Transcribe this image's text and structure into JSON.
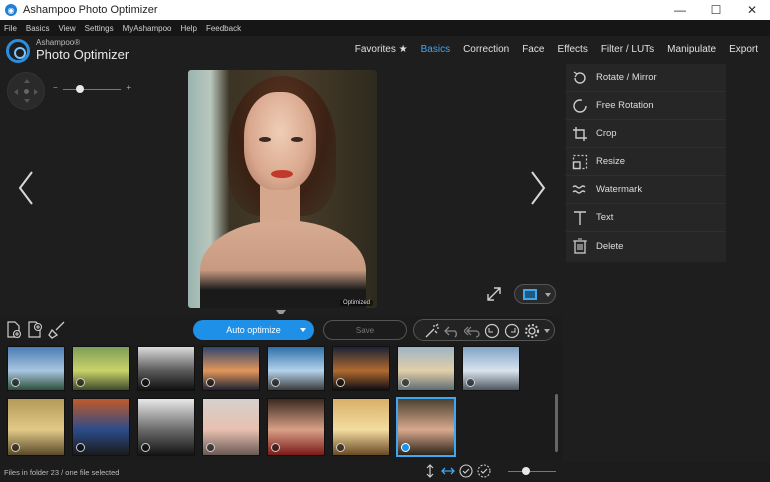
{
  "window": {
    "title": "Ashampoo Photo Optimizer",
    "minimize": "—",
    "maximize": "☐",
    "close": "✕"
  },
  "menu": [
    "File",
    "Basics",
    "View",
    "Settings",
    "MyAshampoo",
    "Help",
    "Feedback"
  ],
  "logo": {
    "line1": "Ashampoo®",
    "line2": "Photo Optimizer"
  },
  "nav": {
    "favorites": "Favorites ★",
    "basics": "Basics",
    "correction": "Correction",
    "face": "Face",
    "effects": "Effects",
    "filter": "Filter / LUTs",
    "manipulate": "Manipulate",
    "export": "Export"
  },
  "zoom": {
    "minus": "−",
    "plus": "+",
    "level": 0.3
  },
  "photo": {
    "tag": "Optimized"
  },
  "panel": {
    "items": [
      {
        "label": "Rotate / Mirror",
        "icon": "rotate-icon"
      },
      {
        "label": "Free Rotation",
        "icon": "free-rotation-icon"
      },
      {
        "label": "Crop",
        "icon": "crop-icon"
      },
      {
        "label": "Resize",
        "icon": "resize-icon"
      },
      {
        "label": "Watermark",
        "icon": "watermark-icon"
      },
      {
        "label": "Text",
        "icon": "text-icon"
      },
      {
        "label": "Delete",
        "icon": "delete-icon"
      }
    ]
  },
  "toolbar": {
    "auto_optimize": "Auto optimize",
    "save": "Save"
  },
  "thumbnails": {
    "row1": [
      {
        "name": "lake-town",
        "colors": [
          "#4a7db5",
          "#a8c6e0",
          "#2d4f3a"
        ]
      },
      {
        "name": "vintage-truck",
        "colors": [
          "#7e9e57",
          "#c9d36a",
          "#3f4a2a"
        ]
      },
      {
        "name": "bw-street",
        "colors": [
          "#dcdcdc",
          "#5a5a5a",
          "#111111"
        ]
      },
      {
        "name": "sunset-coast",
        "colors": [
          "#30466e",
          "#e2965a",
          "#1f2333"
        ]
      },
      {
        "name": "alpine-lake",
        "colors": [
          "#2d6fa8",
          "#b4d2ec",
          "#3b3b3b"
        ]
      },
      {
        "name": "city-night",
        "colors": [
          "#1b2436",
          "#b06a2f",
          "#0e0e14"
        ]
      },
      {
        "name": "skyline-water",
        "colors": [
          "#9fb4c5",
          "#e1cfa8",
          "#5f6c74"
        ]
      },
      {
        "name": "harbor-dusk",
        "colors": [
          "#7fa3c6",
          "#d9e4ee",
          "#4d5560"
        ]
      }
    ],
    "row2": [
      {
        "name": "buddha-statue",
        "colors": [
          "#b59a5a",
          "#e2c987",
          "#5a4a2a"
        ]
      },
      {
        "name": "night-market",
        "colors": [
          "#c05a28",
          "#2b4c8a",
          "#1a1a1a"
        ]
      },
      {
        "name": "bw-canal",
        "colors": [
          "#e8e8e8",
          "#6a6a6a",
          "#141414"
        ]
      },
      {
        "name": "portrait-soft",
        "colors": [
          "#d6d0cc",
          "#e8c0b0",
          "#6a5a55"
        ]
      },
      {
        "name": "portrait-red",
        "colors": [
          "#3a2a20",
          "#d9a088",
          "#7a1a18"
        ]
      },
      {
        "name": "portrait-golden",
        "colors": [
          "#d9b068",
          "#f3dca0",
          "#6a4a24"
        ]
      },
      {
        "name": "portrait-selected",
        "colors": [
          "#4a4230",
          "#d9a88e",
          "#2a2418"
        ]
      }
    ]
  },
  "status": {
    "text": "Files in folder 23 / one file selected"
  },
  "colors": {
    "accent": "#1e90e8",
    "active_nav": "#3fa6f2"
  }
}
